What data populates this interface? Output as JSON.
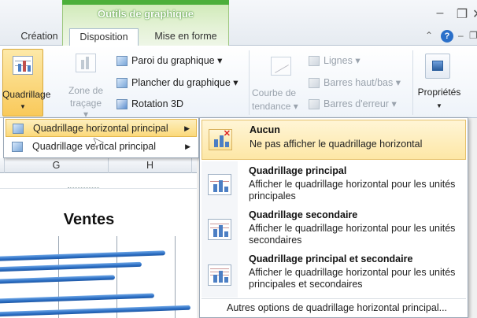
{
  "context_tab_group": {
    "title": "Outils de graphique"
  },
  "tabs": [
    {
      "label": "Création"
    },
    {
      "label": "Disposition"
    },
    {
      "label": "Mise en forme"
    }
  ],
  "ribbon": {
    "quadrillage": "Quadrillage",
    "zone_de": "Zone de",
    "tracage": "traçage",
    "paroi": "Paroi du graphique",
    "plancher": "Plancher du graphique",
    "rotation": "Rotation 3D",
    "courbe_de": "Courbe de",
    "tendance": "tendance",
    "lignes": "Lignes",
    "barres_hautbas": "Barres haut/bas",
    "barres_erreur": "Barres d'erreur",
    "proprietes": "Propriétés"
  },
  "submenu": {
    "item1": "Quadrillage horizontal principal",
    "item2": "Quadrillage vertical principal"
  },
  "sheet": {
    "col_g": "G",
    "col_h": "H",
    "chart_title": "Ventes"
  },
  "gallery": {
    "items": [
      {
        "title": "Aucun",
        "desc": "Ne pas afficher le quadrillage horizontal"
      },
      {
        "title": "Quadrillage principal",
        "desc": "Afficher le quadrillage horizontal pour les unités principales"
      },
      {
        "title": "Quadrillage secondaire",
        "desc": "Afficher le quadrillage horizontal pour les unités secondaires"
      },
      {
        "title": "Quadrillage principal et secondaire",
        "desc": "Afficher le quadrillage horizontal pour les unités principales et secondaires"
      }
    ],
    "footer": "Autres options de quadrillage horizontal principal..."
  },
  "colors": {
    "ribbon_selected": "#f9c95a",
    "context_green": "#4caf3a",
    "bar_blue": "#2c6fc4"
  }
}
